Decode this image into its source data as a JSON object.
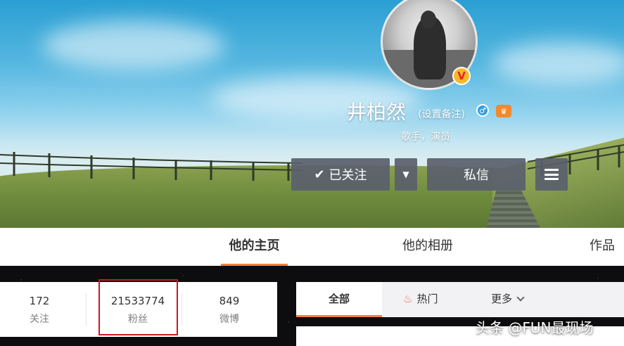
{
  "profile": {
    "name": "井柏然",
    "remark_link": "(设置备注)",
    "description": "歌手，演员",
    "verified_badge": "V",
    "gender_icon": "male-icon",
    "vip_icon": "vip-icon"
  },
  "actions": {
    "follow_label": "已关注",
    "dropdown_icon": "▼",
    "message_label": "私信",
    "menu_icon": "menu-icon"
  },
  "nav_tabs": [
    {
      "label": "他的主页",
      "active": true
    },
    {
      "label": "他的相册",
      "active": false
    },
    {
      "label": "作品",
      "active": false
    }
  ],
  "stats": [
    {
      "value": "172",
      "label": "关注"
    },
    {
      "value": "21533774",
      "label": "粉丝"
    },
    {
      "value": "849",
      "label": "微博"
    }
  ],
  "feed_tabs": [
    {
      "label": "全部",
      "active": true
    },
    {
      "label": "热门",
      "icon": "fire-icon"
    },
    {
      "label": "更多",
      "icon": "chevron-down-icon"
    }
  ],
  "watermark": "头条 @FUN最现场",
  "colors": {
    "accent": "#fa7d3c",
    "highlight_box": "#d0161c",
    "button_bg": "#5a606c"
  }
}
